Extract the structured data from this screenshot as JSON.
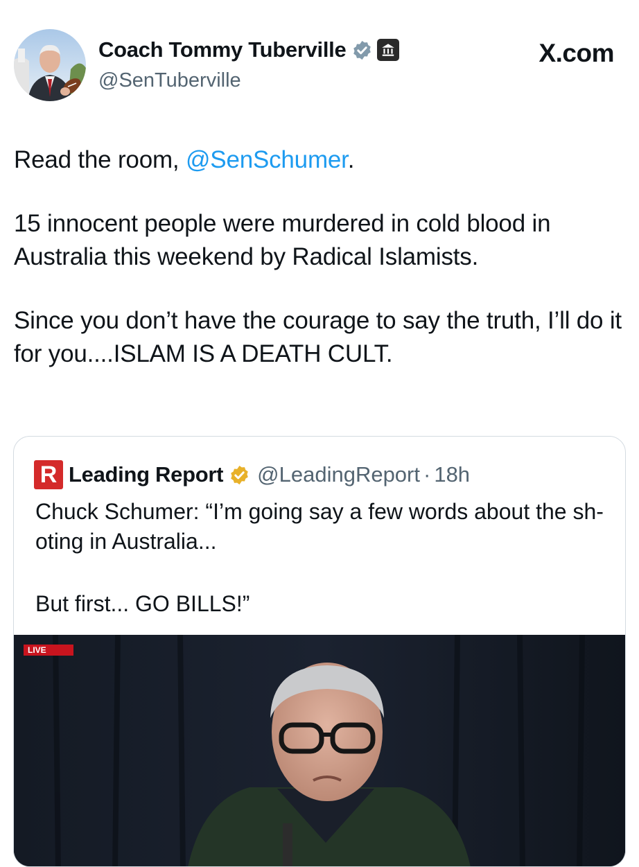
{
  "header": {
    "display_name": "Coach Tommy Tuberville",
    "handle": "@SenTuberville",
    "site": "X.com"
  },
  "tweet": {
    "p1_pre": "Read the room, ",
    "p1_mention": "@SenSchumer",
    "p1_post": ".",
    "p2": "15 innocent people were murdered in cold blood in Australia this weekend by Radical Islamists.",
    "p3": "Since you don’t have the courage to say the truth, I’ll do it for you....ISLAM IS A DEATH CULT."
  },
  "quote": {
    "name": "Leading Report",
    "handle": "@LeadingReport",
    "separator": "·",
    "time": "18h",
    "text_p1": "Chuck Schumer: “I’m going say a few words about the sh-oting in Australia...",
    "text_p2": "But first... GO BILLS!”",
    "logo_letter": "R",
    "live_label": "LIVE"
  },
  "icons": {
    "verified": "verified-badge-icon",
    "government": "government-building-icon",
    "gold_verified": "gold-verified-badge-icon"
  },
  "colors": {
    "mention": "#1d9bf0",
    "secondary_text": "#536471",
    "gold_badge": "#e8b12a",
    "live_red": "#c8141e"
  }
}
